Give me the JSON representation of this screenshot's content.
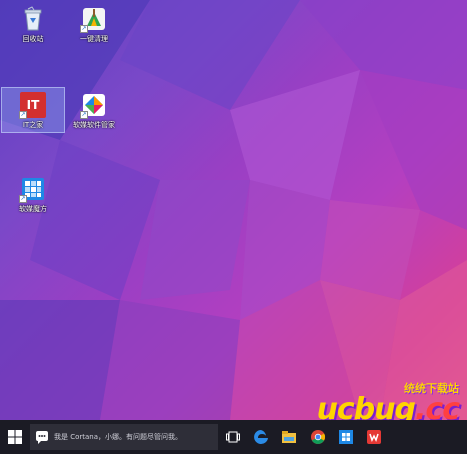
{
  "desktop": {
    "icons": [
      {
        "label": "回收站",
        "icon": "recycle-bin-icon"
      },
      {
        "label": "一键清理",
        "icon": "broom-cleaner-icon"
      },
      {
        "label": "IT之家",
        "icon": "ithome-icon"
      },
      {
        "label": "软媒软件管家",
        "icon": "software-manager-icon"
      },
      {
        "label": "软媒魔方",
        "icon": "rubik-cube-icon"
      }
    ],
    "ithome_logo_text": "IT"
  },
  "watermark": {
    "small": "统统下载站",
    "brand": "ucbug",
    "suffix": ".cc"
  },
  "taskbar": {
    "search_placeholder": "我是 Cortana，小娜。有问题尽管问我。",
    "items": [
      "start-icon",
      "task-view-icon",
      "edge-icon",
      "file-explorer-icon",
      "chrome-icon",
      "store-icon",
      "wps-icon"
    ]
  },
  "colors": {
    "taskbar": "#1b1b24",
    "accent": "#0078d7"
  }
}
